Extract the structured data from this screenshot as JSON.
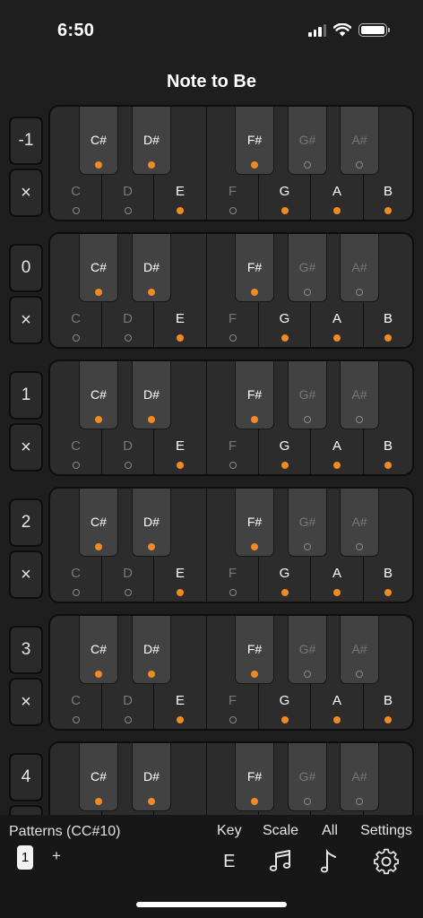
{
  "status_bar": {
    "time": "6:50"
  },
  "title": "Note to Be",
  "accent_color": "#f08a24",
  "rows": [
    {
      "octave": "-1",
      "clear": "×"
    },
    {
      "octave": "0",
      "clear": "×"
    },
    {
      "octave": "1",
      "clear": "×"
    },
    {
      "octave": "2",
      "clear": "×"
    },
    {
      "octave": "3",
      "clear": "×"
    },
    {
      "octave": "4",
      "clear": "×"
    }
  ],
  "white_keys": [
    {
      "label": "C",
      "active": false
    },
    {
      "label": "D",
      "active": false
    },
    {
      "label": "E",
      "active": true
    },
    {
      "label": "F",
      "active": false
    },
    {
      "label": "G",
      "active": true
    },
    {
      "label": "A",
      "active": true
    },
    {
      "label": "B",
      "active": true
    }
  ],
  "black_keys": [
    {
      "label": "C#",
      "active": true
    },
    {
      "label": "D#",
      "active": true
    },
    {
      "label": "F#",
      "active": true
    },
    {
      "label": "G#",
      "active": false
    },
    {
      "label": "A#",
      "active": false
    }
  ],
  "bottom": {
    "patterns_label": "Patterns (CC#10)",
    "pattern_selected": "1",
    "add_label": "+",
    "key_label": "Key",
    "key_value": "E",
    "scale_label": "Scale",
    "scale_icon": "music-notes-icon",
    "all_label": "All",
    "all_icon": "music-note-icon",
    "settings_label": "Settings",
    "settings_icon": "gear-icon"
  }
}
